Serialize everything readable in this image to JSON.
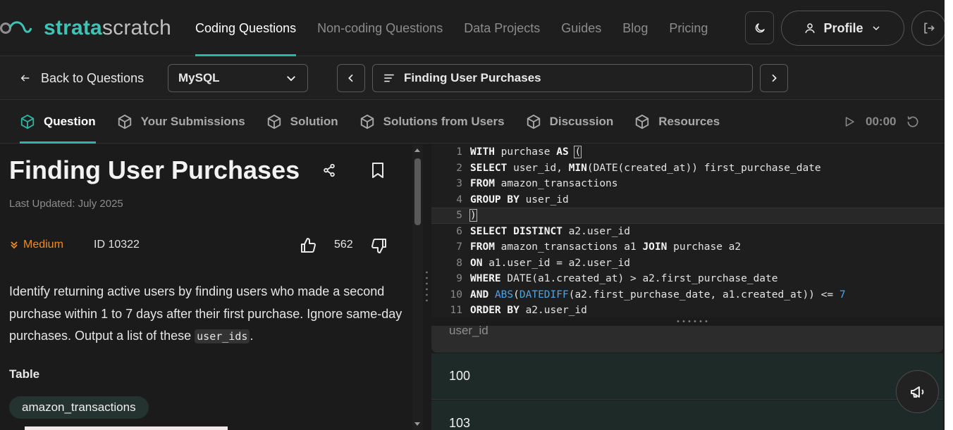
{
  "brand": {
    "part1": "strata",
    "part2": "scratch"
  },
  "nav": {
    "links": [
      {
        "label": "Coding Questions"
      },
      {
        "label": "Non-coding Questions"
      },
      {
        "label": "Data Projects"
      },
      {
        "label": "Guides"
      },
      {
        "label": "Blog"
      },
      {
        "label": "Pricing"
      }
    ],
    "profile_label": "Profile"
  },
  "toolbar": {
    "back_label": "Back to Questions",
    "language": "MySQL",
    "question_title": "Finding User Purchases"
  },
  "tabs": [
    {
      "label": "Question"
    },
    {
      "label": "Your Submissions"
    },
    {
      "label": "Solution"
    },
    {
      "label": "Solutions from Users"
    },
    {
      "label": "Discussion"
    },
    {
      "label": "Resources"
    }
  ],
  "timer": "00:00",
  "question": {
    "title": "Finding User Purchases",
    "updated": "Last Updated: July 2025",
    "difficulty": "Medium",
    "id_label": "ID 10322",
    "likes": "562",
    "description_before": "Identify returning active users by finding users who made a second purchase within 1 to 7 days after their first purchase. Ignore same-day purchases. Output a list of these ",
    "description_code": "user_ids",
    "description_after": ".",
    "table_heading": "Table",
    "table_name": "amazon_transactions"
  },
  "editor": {
    "lines": [
      {
        "n": "1"
      },
      {
        "n": "2"
      },
      {
        "n": "3"
      },
      {
        "n": "4"
      },
      {
        "n": "5"
      },
      {
        "n": "6"
      },
      {
        "n": "7"
      },
      {
        "n": "8"
      },
      {
        "n": "9"
      },
      {
        "n": "10"
      },
      {
        "n": "11"
      }
    ],
    "code": {
      "l1_kw1": "WITH",
      "l1_t1": " purchase ",
      "l1_kw2": "AS",
      "l1_t2": " ",
      "l1_paren": "(",
      "l2_kw1": "SELECT",
      "l2_t1": " user_id, ",
      "l2_kw2": "MIN",
      "l2_t2": "(DATE(created_at)) first_purchase_date",
      "l3_kw1": "FROM",
      "l3_t1": " amazon_transactions",
      "l4_kw1": "GROUP BY",
      "l4_t1": " user_id",
      "l5_paren": ")",
      "l6_kw1": "SELECT DISTINCT",
      "l6_t1": " a2.user_id",
      "l7_kw1": "FROM",
      "l7_t1": " amazon_transactions a1 ",
      "l7_kw2": "JOIN",
      "l7_t2": " purchase a2",
      "l8_kw1": "ON",
      "l8_t1": " a1.user_id = a2.user_id",
      "l9_kw1": "WHERE",
      "l9_t1": " DATE(a1.created_at) > a2.first_purchase_date",
      "l10_kw1": "AND",
      "l10_t1": " ",
      "l10_fn1": "ABS",
      "l10_t2": "(",
      "l10_fn2": "DATEDIFF",
      "l10_t3": "(a2.first_purchase_date, a1.created_at)) <= ",
      "l10_num": "7",
      "l11_kw1": "ORDER BY",
      "l11_t1": " a2.user_id"
    }
  },
  "results": {
    "column": "user_id",
    "rows": [
      {
        "value": "100"
      },
      {
        "value": "103"
      }
    ]
  },
  "colors": {
    "accent": "#2bb5a5",
    "difficulty": "#f08a24",
    "keyword_blue": "#4aa6e8"
  },
  "icons": [
    "moon-icon",
    "user-icon",
    "chevron-down-icon",
    "logout-icon",
    "arrow-left-icon",
    "chevron-left-icon",
    "chevron-right-icon",
    "list-icon",
    "cube-icon",
    "play-icon",
    "reset-icon",
    "share-icon",
    "bookmark-icon",
    "double-chevron-down-icon",
    "thumbs-up-icon",
    "thumbs-down-icon",
    "megaphone-icon"
  ]
}
